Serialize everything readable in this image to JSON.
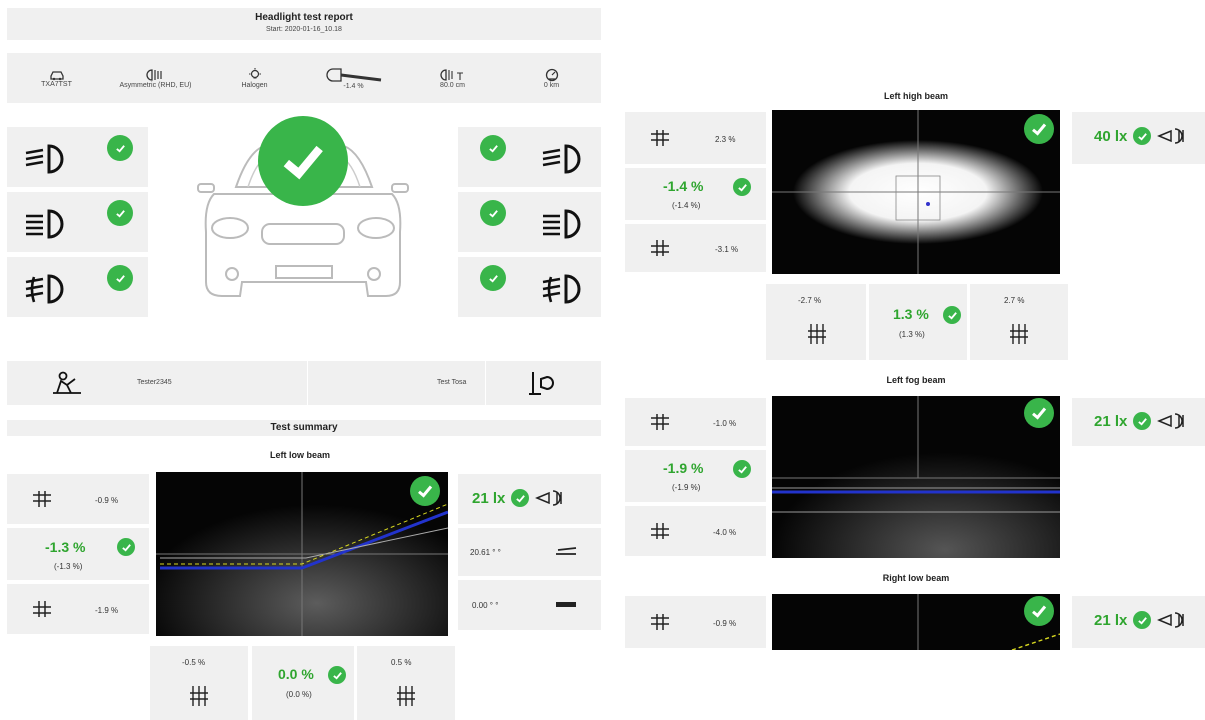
{
  "header": {
    "title": "Headlight test report",
    "start": "Start: 2020-01-16_10.18"
  },
  "vehicle_info": [
    {
      "icon": "car-icon",
      "label": "TXA7TST"
    },
    {
      "icon": "headlight-type-icon",
      "label": "Asymmetric (RHD, EU)"
    },
    {
      "icon": "bulb-icon",
      "label": "Halogen"
    },
    {
      "icon": "inclination-icon",
      "label": "-1.4 %"
    },
    {
      "icon": "headlight-height-icon",
      "label": "80.0 cm"
    },
    {
      "icon": "odometer-icon",
      "label": "0 km"
    }
  ],
  "operator": {
    "left": "Tester2345",
    "right": "Test Tosa"
  },
  "summary_title": "Test summary",
  "left_low": {
    "title": "Left low beam",
    "upper": "-0.9 %",
    "main": "-1.3 %",
    "main_sub": "(-1.3 %)",
    "lower": "-1.9 %",
    "lux": "21 lx",
    "angle": "20.61 ° °",
    "tilt": "0.00 ° °",
    "bottom_left": "-0.5 %",
    "bottom_main": "0.0 %",
    "bottom_sub": "(0.0 %)",
    "bottom_right": "0.5 %"
  },
  "left_high": {
    "title": "Left high beam",
    "upper": "2.3 %",
    "main": "-1.4 %",
    "main_sub": "(-1.4 %)",
    "lower": "-3.1 %",
    "lux": "40 lx",
    "bottom_left": "-2.7 %",
    "bottom_main": "1.3 %",
    "bottom_sub": "(1.3 %)",
    "bottom_right": "2.7 %"
  },
  "left_fog": {
    "title": "Left fog beam",
    "upper": "-1.0 %",
    "main": "-1.9 %",
    "main_sub": "(-1.9 %)",
    "lower": "-4.0 %",
    "lux": "21 lx"
  },
  "right_low": {
    "title": "Right low beam",
    "upper": "-0.9 %",
    "lux": "21 lx"
  },
  "colors": {
    "green": "#39b54a",
    "panel": "#f0f0f0",
    "beam_bg": "#050505",
    "cutoff_blue": "#2233cc",
    "cutoff_yellow": "#d8d820"
  }
}
